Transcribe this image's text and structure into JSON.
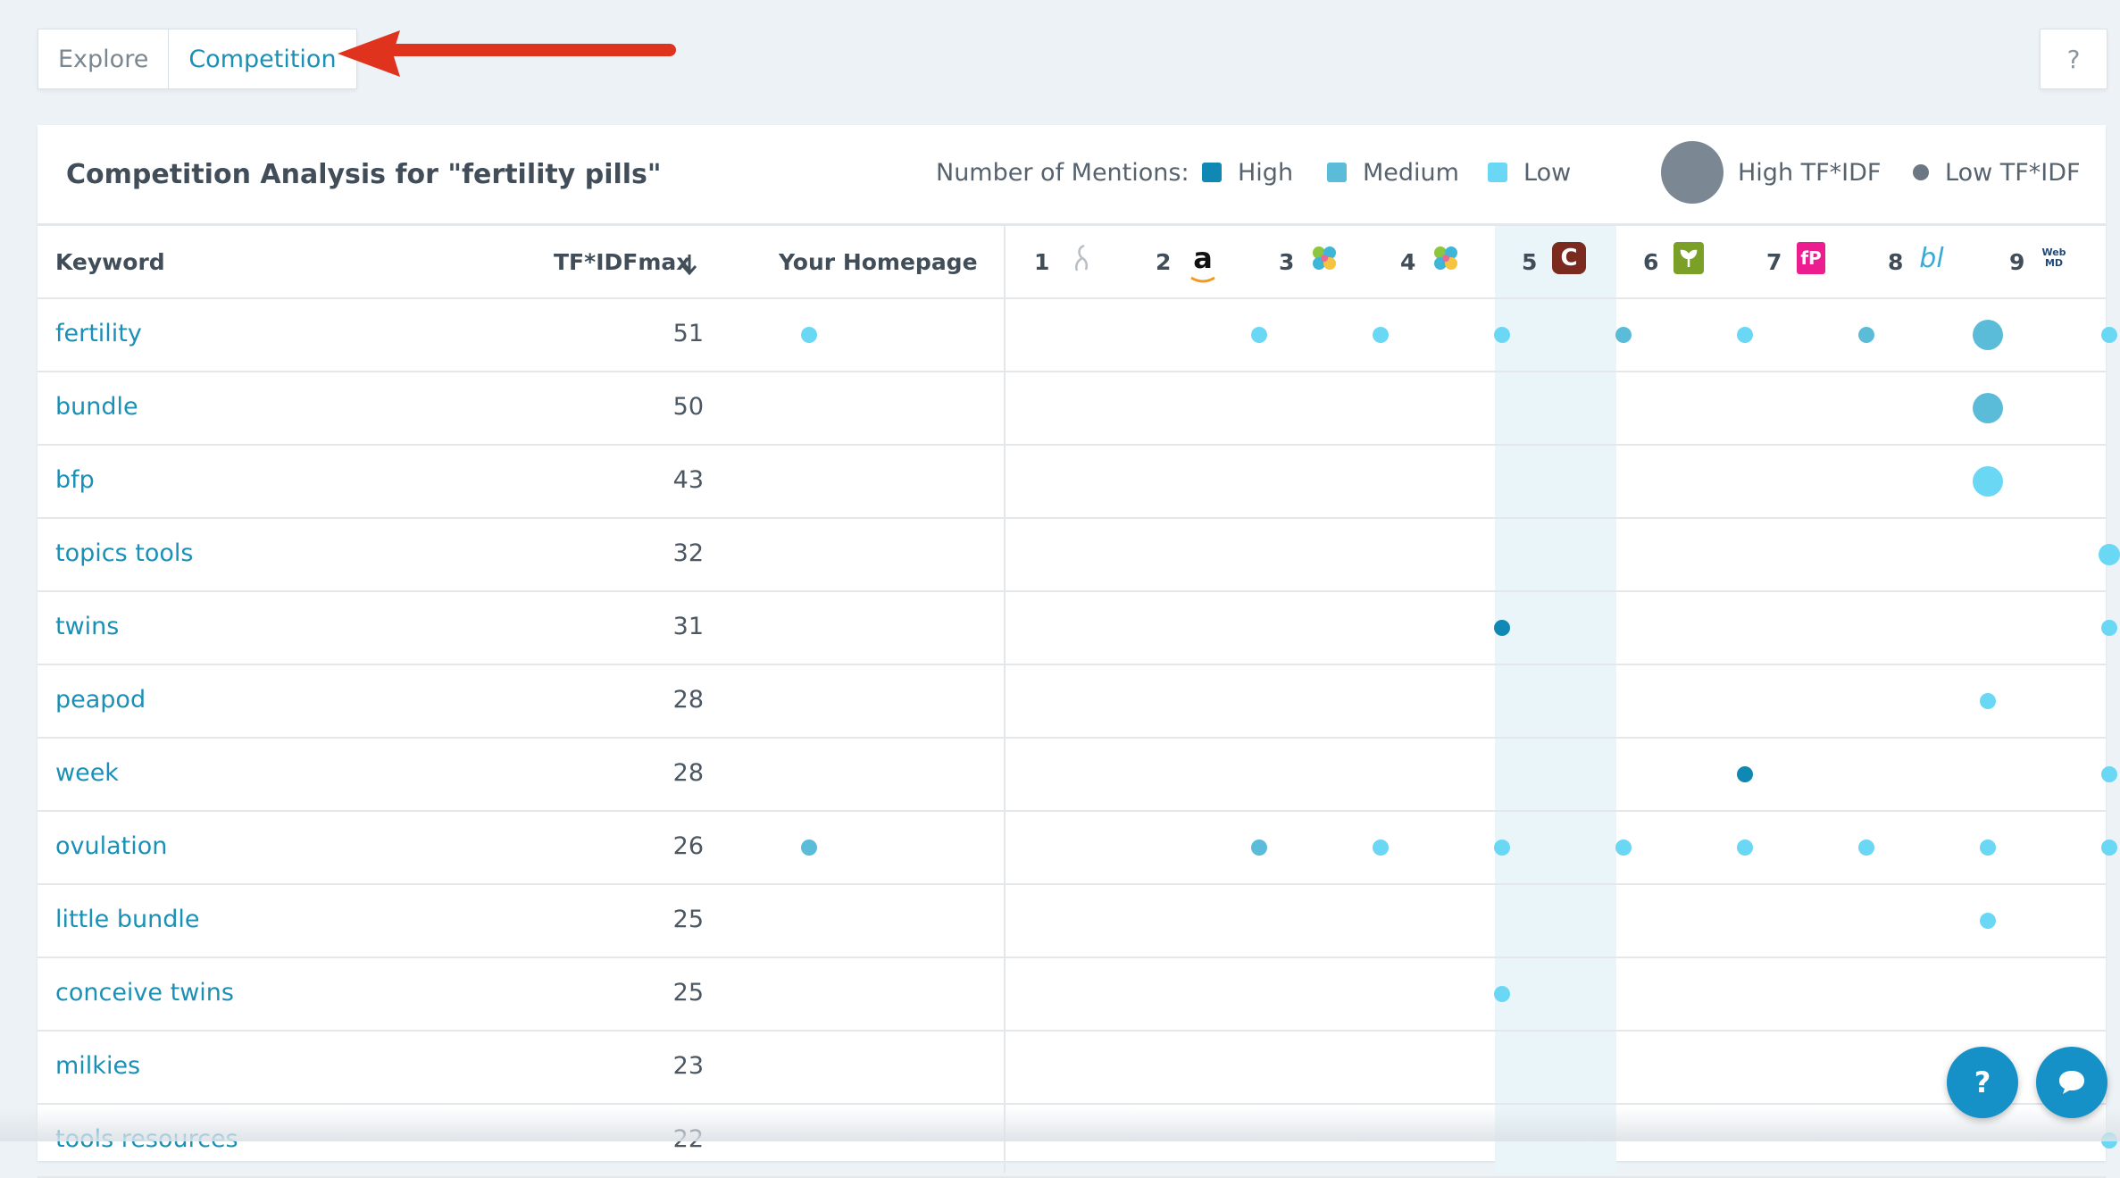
{
  "tabs": {
    "explore": "Explore",
    "competition": "Competition"
  },
  "help_label": "?",
  "title": "Competition Analysis for \"fertility pills\"",
  "legend": {
    "mentions_label": "Number of Mentions:",
    "high": "High",
    "medium": "Medium",
    "low": "Low",
    "high_tfidf": "High TF*IDF",
    "low_tfidf": "Low TF*IDF"
  },
  "colors": {
    "high": "#0f88b4",
    "medium": "#5bbcd9",
    "low": "#6ad8f5",
    "link": "#1b90b6",
    "highlight_column": "#eaf5fa"
  },
  "columns": {
    "keyword": "Keyword",
    "tfidf": "TF*IDFmax",
    "homepage": "Your Homepage",
    "competitors": [
      {
        "rank": "1",
        "icon": "stork-logo-icon"
      },
      {
        "rank": "2",
        "icon": "amazon-logo-icon",
        "glyph": "a"
      },
      {
        "rank": "3",
        "icon": "leaf-logo-icon"
      },
      {
        "rank": "4",
        "icon": "leaf-logo-icon"
      },
      {
        "rank": "5",
        "icon": "c-logo-icon",
        "glyph": "C"
      },
      {
        "rank": "6",
        "icon": "sprout-logo-icon"
      },
      {
        "rank": "7",
        "icon": "fp-logo-icon",
        "glyph": "fP"
      },
      {
        "rank": "8",
        "icon": "bl-logo-icon",
        "glyph": "bl"
      },
      {
        "rank": "9",
        "icon": "webmd-logo-icon",
        "glyph": "WebMD"
      }
    ]
  },
  "rows": [
    {
      "keyword": "fertility",
      "tfidf": "51",
      "cells": [
        [
          "low",
          "sm"
        ],
        null,
        [
          "low",
          "sm"
        ],
        [
          "low",
          "sm"
        ],
        [
          "low",
          "sm"
        ],
        [
          "medium",
          "sm"
        ],
        [
          "low",
          "sm"
        ],
        [
          "medium",
          "sm"
        ],
        [
          "medium",
          "lg"
        ],
        [
          "low",
          "sm"
        ]
      ]
    },
    {
      "keyword": "bundle",
      "tfidf": "50",
      "cells": [
        null,
        null,
        null,
        null,
        null,
        null,
        null,
        null,
        [
          "medium",
          "lg"
        ],
        null
      ]
    },
    {
      "keyword": "bfp",
      "tfidf": "43",
      "cells": [
        null,
        null,
        null,
        null,
        null,
        null,
        null,
        null,
        [
          "low",
          "lg"
        ],
        null
      ]
    },
    {
      "keyword": "topics tools",
      "tfidf": "32",
      "cells": [
        null,
        null,
        null,
        null,
        null,
        null,
        null,
        null,
        null,
        [
          "low",
          "md"
        ]
      ]
    },
    {
      "keyword": "twins",
      "tfidf": "31",
      "cells": [
        null,
        null,
        null,
        null,
        [
          "high",
          "sm"
        ],
        null,
        null,
        null,
        null,
        [
          "low",
          "sm"
        ]
      ]
    },
    {
      "keyword": "peapod",
      "tfidf": "28",
      "cells": [
        null,
        null,
        null,
        null,
        null,
        null,
        null,
        null,
        [
          "low",
          "sm"
        ],
        null
      ]
    },
    {
      "keyword": "week",
      "tfidf": "28",
      "cells": [
        null,
        null,
        null,
        null,
        null,
        null,
        [
          "high",
          "sm"
        ],
        null,
        null,
        [
          "low",
          "sm"
        ]
      ]
    },
    {
      "keyword": "ovulation",
      "tfidf": "26",
      "cells": [
        [
          "medium",
          "sm"
        ],
        null,
        [
          "medium",
          "sm"
        ],
        [
          "low",
          "sm"
        ],
        [
          "low",
          "sm"
        ],
        [
          "low",
          "sm"
        ],
        [
          "low",
          "sm"
        ],
        [
          "low",
          "sm"
        ],
        [
          "low",
          "sm"
        ],
        [
          "low",
          "sm"
        ]
      ]
    },
    {
      "keyword": "little bundle",
      "tfidf": "25",
      "cells": [
        null,
        null,
        null,
        null,
        null,
        null,
        null,
        null,
        [
          "low",
          "sm"
        ],
        null
      ]
    },
    {
      "keyword": "conceive twins",
      "tfidf": "25",
      "cells": [
        null,
        null,
        null,
        null,
        [
          "low",
          "sm"
        ],
        null,
        null,
        null,
        null,
        null
      ]
    },
    {
      "keyword": "milkies",
      "tfidf": "23",
      "cells": [
        null,
        null,
        null,
        null,
        null,
        null,
        null,
        null,
        [
          "low",
          "sm"
        ],
        null
      ]
    },
    {
      "keyword": "tools resources",
      "tfidf": "22",
      "cells": [
        null,
        null,
        null,
        null,
        null,
        null,
        null,
        null,
        null,
        [
          "low",
          "sm"
        ]
      ]
    }
  ],
  "fab": {
    "help": "?"
  }
}
